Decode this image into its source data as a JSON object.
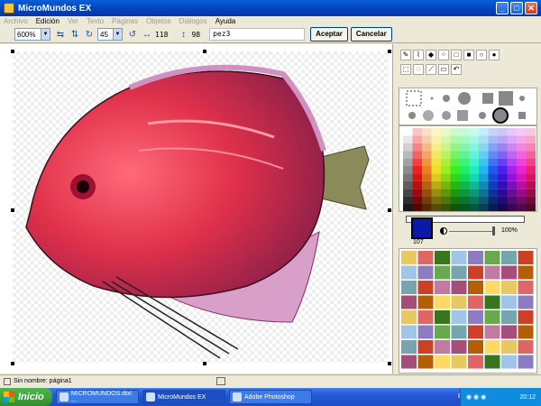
{
  "window": {
    "title": "MicroMundos EX",
    "min_label": "_",
    "max_label": "□",
    "close_label": "✕"
  },
  "menu": [
    {
      "label": "Archivo",
      "enabled": false
    },
    {
      "label": "Edición",
      "enabled": true
    },
    {
      "label": "Ver",
      "enabled": false
    },
    {
      "label": "Texto",
      "enabled": false
    },
    {
      "label": "Páginas",
      "enabled": false
    },
    {
      "label": "Objetos",
      "enabled": false
    },
    {
      "label": "Diálogos",
      "enabled": false
    },
    {
      "label": "Ayuda",
      "enabled": true
    }
  ],
  "toolbar": {
    "zoom_value": "600%",
    "rotate_value": "45",
    "width_value": "118",
    "height_value": "98",
    "name_value": "pez3",
    "accept_label": "Aceptar",
    "cancel_label": "Cancelar"
  },
  "colors": {
    "current": "#0a1aa8",
    "titlebar": "#0341b8",
    "taskbar": "#2458d6"
  },
  "paint": {
    "color_number": "107",
    "opacity": "100%"
  },
  "status": {
    "page_text": "Sin nombre: página1"
  },
  "taskbar": {
    "start_label": "Inicio",
    "tasks": [
      {
        "label": "MICROMUNDOS.doc ..."
      },
      {
        "label": "MicroMundos EX"
      },
      {
        "label": "Adobe Photoshop"
      }
    ],
    "language": "ES",
    "clock": "20:12"
  }
}
